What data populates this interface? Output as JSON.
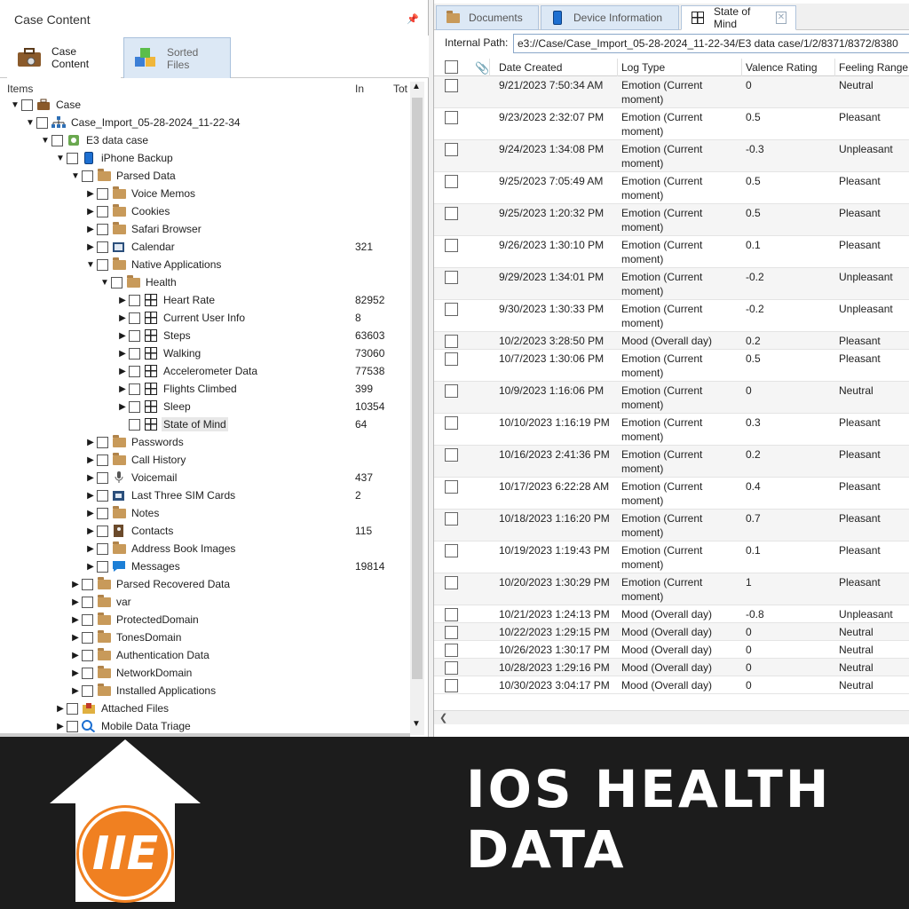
{
  "left_panel": {
    "title": "Case Content",
    "tabs": [
      {
        "label": "Case Content"
      },
      {
        "label": "Sorted Files"
      }
    ],
    "columns": {
      "items": "Items",
      "in": "In",
      "tot": "Tot"
    },
    "tree": [
      {
        "label": "Case",
        "count": "",
        "depth": 0,
        "expanded": true,
        "icon": "briefcase-icon"
      },
      {
        "label": "Case_Import_05-28-2024_11-22-34",
        "count": "",
        "depth": 1,
        "expanded": true,
        "icon": "hierarchy-icon"
      },
      {
        "label": "E3 data case",
        "count": "",
        "depth": 2,
        "expanded": true,
        "icon": "case-file-icon"
      },
      {
        "label": "iPhone Backup",
        "count": "",
        "depth": 3,
        "expanded": true,
        "icon": "phone-icon"
      },
      {
        "label": "Parsed Data",
        "count": "",
        "depth": 4,
        "expanded": true,
        "icon": "folder-icon"
      },
      {
        "label": "Voice Memos",
        "count": "",
        "depth": 5,
        "expanded": false,
        "icon": "folder-icon"
      },
      {
        "label": "Cookies",
        "count": "",
        "depth": 5,
        "expanded": false,
        "icon": "folder-icon"
      },
      {
        "label": "Safari Browser",
        "count": "",
        "depth": 5,
        "expanded": false,
        "icon": "folder-icon"
      },
      {
        "label": "Calendar",
        "count": "321",
        "depth": 5,
        "expanded": false,
        "icon": "calendar-icon"
      },
      {
        "label": "Native Applications",
        "count": "",
        "depth": 5,
        "expanded": true,
        "icon": "folder-icon"
      },
      {
        "label": "Health",
        "count": "",
        "depth": 6,
        "expanded": true,
        "icon": "folder-icon"
      },
      {
        "label": "Heart Rate",
        "count": "82952",
        "depth": 7,
        "expanded": false,
        "icon": "table-icon"
      },
      {
        "label": "Current User Info",
        "count": "8",
        "depth": 7,
        "expanded": false,
        "icon": "table-icon"
      },
      {
        "label": "Steps",
        "count": "63603",
        "depth": 7,
        "expanded": false,
        "icon": "table-icon"
      },
      {
        "label": "Walking",
        "count": "73060",
        "depth": 7,
        "expanded": false,
        "icon": "table-icon"
      },
      {
        "label": "Accelerometer Data",
        "count": "77538",
        "depth": 7,
        "expanded": false,
        "icon": "table-icon"
      },
      {
        "label": "Flights Climbed",
        "count": "399",
        "depth": 7,
        "expanded": false,
        "icon": "table-icon"
      },
      {
        "label": "Sleep",
        "count": "10354",
        "depth": 7,
        "expanded": false,
        "icon": "table-icon"
      },
      {
        "label": "State of Mind",
        "count": "64",
        "depth": 7,
        "expanded": null,
        "icon": "table-icon",
        "selected": true
      },
      {
        "label": "Passwords",
        "count": "",
        "depth": 5,
        "expanded": false,
        "icon": "folder-icon"
      },
      {
        "label": "Call History",
        "count": "",
        "depth": 5,
        "expanded": false,
        "icon": "folder-icon"
      },
      {
        "label": "Voicemail",
        "count": "437",
        "depth": 5,
        "expanded": false,
        "icon": "microphone-icon"
      },
      {
        "label": "Last Three SIM Cards",
        "count": "2",
        "depth": 5,
        "expanded": false,
        "icon": "sim-card-icon"
      },
      {
        "label": "Notes",
        "count": "",
        "depth": 5,
        "expanded": false,
        "icon": "folder-icon"
      },
      {
        "label": "Contacts",
        "count": "115",
        "depth": 5,
        "expanded": false,
        "icon": "contacts-icon"
      },
      {
        "label": "Address Book Images",
        "count": "",
        "depth": 5,
        "expanded": false,
        "icon": "folder-icon"
      },
      {
        "label": "Messages",
        "count": "19814",
        "depth": 5,
        "expanded": false,
        "icon": "message-icon"
      },
      {
        "label": "Parsed Recovered Data",
        "count": "",
        "depth": 4,
        "expanded": false,
        "icon": "folder-icon"
      },
      {
        "label": "var",
        "count": "",
        "depth": 4,
        "expanded": false,
        "icon": "folder-icon"
      },
      {
        "label": "ProtectedDomain",
        "count": "",
        "depth": 4,
        "expanded": false,
        "icon": "folder-icon"
      },
      {
        "label": "TonesDomain",
        "count": "",
        "depth": 4,
        "expanded": false,
        "icon": "folder-icon"
      },
      {
        "label": "Authentication Data",
        "count": "",
        "depth": 4,
        "expanded": false,
        "icon": "folder-icon"
      },
      {
        "label": "NetworkDomain",
        "count": "",
        "depth": 4,
        "expanded": false,
        "icon": "folder-icon"
      },
      {
        "label": "Installed Applications",
        "count": "",
        "depth": 4,
        "expanded": false,
        "icon": "folder-icon"
      },
      {
        "label": "Attached Files",
        "count": "",
        "depth": 3,
        "expanded": false,
        "icon": "attached-files-icon"
      },
      {
        "label": "Mobile Data Triage",
        "count": "",
        "depth": 3,
        "expanded": false,
        "icon": "triage-icon"
      }
    ]
  },
  "right_panel": {
    "tabs": [
      {
        "label": "Documents",
        "icon": "folder-icon"
      },
      {
        "label": "Device Information",
        "icon": "phone-icon"
      },
      {
        "label": "State of Mind",
        "icon": "table-icon"
      }
    ],
    "internal_path": {
      "label": "Internal Path:",
      "value": "e3://Case/Case_Import_05-28-2024_11-22-34/E3 data case/1/2/8371/8372/8380"
    },
    "columns": [
      "Date Created",
      "Log Type",
      "Valence Rating",
      "Feeling Range"
    ],
    "rows": [
      {
        "date": "9/21/2023  7:50:34 AM",
        "type": "Emotion (Current moment)",
        "valence": "0",
        "range": "Neutral"
      },
      {
        "date": "9/23/2023  2:32:07 PM",
        "type": "Emotion (Current moment)",
        "valence": "0.5",
        "range": "Pleasant"
      },
      {
        "date": "9/24/2023  1:34:08 PM",
        "type": "Emotion (Current moment)",
        "valence": "-0.3",
        "range": "Unpleasant"
      },
      {
        "date": "9/25/2023  7:05:49 AM",
        "type": "Emotion (Current moment)",
        "valence": "0.5",
        "range": "Pleasant"
      },
      {
        "date": "9/25/2023  1:20:32 PM",
        "type": "Emotion (Current moment)",
        "valence": "0.5",
        "range": "Pleasant"
      },
      {
        "date": "9/26/2023  1:30:10 PM",
        "type": "Emotion (Current moment)",
        "valence": "0.1",
        "range": "Pleasant"
      },
      {
        "date": "9/29/2023  1:34:01 PM",
        "type": "Emotion (Current moment)",
        "valence": "-0.2",
        "range": "Unpleasant"
      },
      {
        "date": "9/30/2023  1:30:33 PM",
        "type": "Emotion (Current moment)",
        "valence": "-0.2",
        "range": "Unpleasant"
      },
      {
        "date": "10/2/2023  3:28:50 PM",
        "type": "Mood (Overall day)",
        "valence": "0.2",
        "range": "Pleasant"
      },
      {
        "date": "10/7/2023  1:30:06 PM",
        "type": "Emotion (Current moment)",
        "valence": "0.5",
        "range": "Pleasant"
      },
      {
        "date": "10/9/2023  1:16:06 PM",
        "type": "Emotion (Current moment)",
        "valence": "0",
        "range": "Neutral"
      },
      {
        "date": "10/10/2023  1:16:19 PM",
        "type": "Emotion (Current moment)",
        "valence": "0.3",
        "range": "Pleasant"
      },
      {
        "date": "10/16/2023  2:41:36 PM",
        "type": "Emotion (Current moment)",
        "valence": "0.2",
        "range": "Pleasant"
      },
      {
        "date": "10/17/2023  6:22:28 AM",
        "type": "Emotion (Current moment)",
        "valence": "0.4",
        "range": "Pleasant"
      },
      {
        "date": "10/18/2023  1:16:20 PM",
        "type": "Emotion (Current moment)",
        "valence": "0.7",
        "range": "Pleasant"
      },
      {
        "date": "10/19/2023  1:19:43 PM",
        "type": "Emotion (Current moment)",
        "valence": "0.1",
        "range": "Pleasant"
      },
      {
        "date": "10/20/2023  1:30:29 PM",
        "type": "Emotion (Current moment)",
        "valence": "1",
        "range": "Pleasant"
      },
      {
        "date": "10/21/2023  1:24:13 PM",
        "type": "Mood (Overall day)",
        "valence": "-0.8",
        "range": "Unpleasant"
      },
      {
        "date": "10/22/2023  1:29:15 PM",
        "type": "Mood (Overall day)",
        "valence": "0",
        "range": "Neutral"
      },
      {
        "date": "10/26/2023  1:30:17 PM",
        "type": "Mood (Overall day)",
        "valence": "0",
        "range": "Neutral"
      },
      {
        "date": "10/28/2023  1:29:16 PM",
        "type": "Mood (Overall day)",
        "valence": "0",
        "range": "Neutral"
      },
      {
        "date": "10/30/2023  3:04:17 PM",
        "type": "Mood (Overall day)",
        "valence": "0",
        "range": "Neutral"
      }
    ]
  },
  "banner": {
    "title": "IOS HEALTH DATA",
    "logo_text": "IIE",
    "accent": "#f08021",
    "background": "#1c1c1c"
  }
}
